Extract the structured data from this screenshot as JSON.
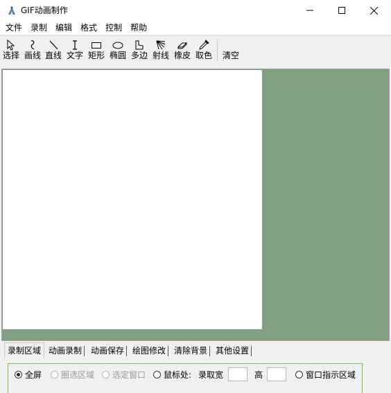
{
  "window": {
    "title": "GIF动画制作",
    "min_icon": "minimize-icon",
    "max_icon": "maximize-icon",
    "close_icon": "close-icon"
  },
  "menu": [
    "文件",
    "录制",
    "编辑",
    "格式",
    "控制",
    "帮助"
  ],
  "toolbar": {
    "tools": [
      {
        "label": "选择",
        "icon": "pointer-icon"
      },
      {
        "label": "画线",
        "icon": "freehand-icon"
      },
      {
        "label": "直线",
        "icon": "line-icon"
      },
      {
        "label": "文字",
        "icon": "text-cursor-icon"
      },
      {
        "label": "矩形",
        "icon": "rectangle-icon"
      },
      {
        "label": "椭圆",
        "icon": "ellipse-icon"
      },
      {
        "label": "多边",
        "icon": "polygon-icon"
      },
      {
        "label": "射线",
        "icon": "rays-icon"
      },
      {
        "label": "橡皮",
        "icon": "eraser-icon"
      },
      {
        "label": "取色",
        "icon": "eyedropper-icon"
      },
      {
        "label": "清空",
        "icon": ""
      }
    ]
  },
  "canvas": {
    "background_color": "#81a081",
    "drawing_color": "#ffffff"
  },
  "tabs": [
    "录制区域",
    "动画录制",
    "动画保存",
    "绘图修改",
    "清除背景",
    "其他设置"
  ],
  "record_area": {
    "options": [
      {
        "label": "全屏",
        "checked": true,
        "enabled": true
      },
      {
        "label": "圈选区域",
        "checked": false,
        "enabled": false
      },
      {
        "label": "选定窗口",
        "checked": false,
        "enabled": false
      },
      {
        "label": "鼠标处:",
        "checked": false,
        "enabled": true
      },
      {
        "label": "窗口指示区域",
        "checked": false,
        "enabled": true
      }
    ],
    "width_label": "录取宽",
    "height_label": "高",
    "width_value": "",
    "height_value": ""
  }
}
